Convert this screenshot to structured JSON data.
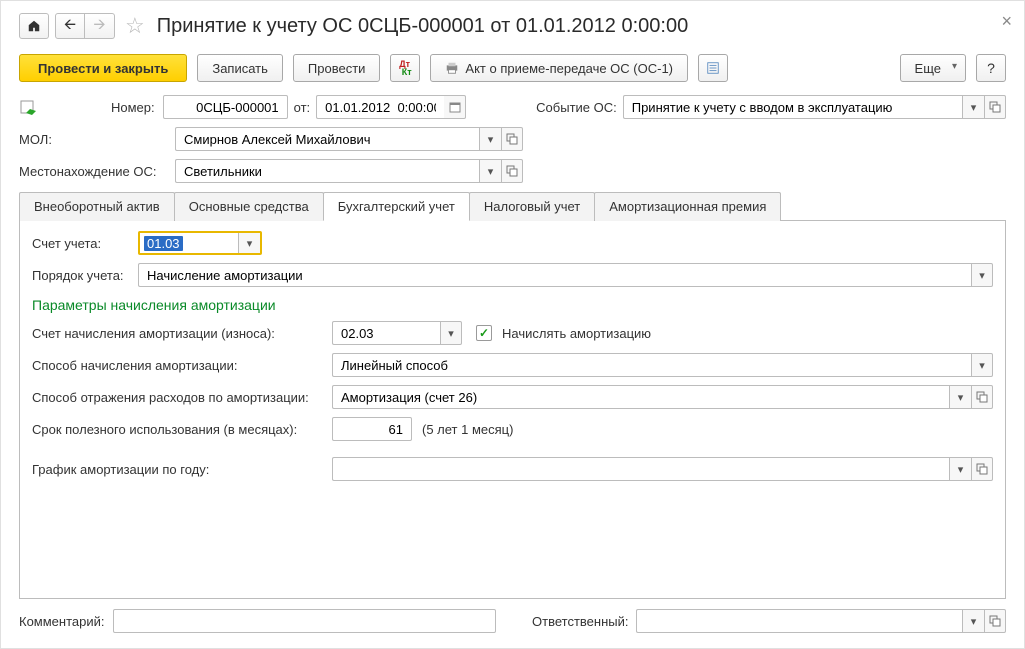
{
  "title": "Принятие к учету ОС 0СЦБ-000001 от 01.01.2012 0:00:00",
  "toolbar": {
    "post_close": "Провести и закрыть",
    "save": "Записать",
    "post": "Провести",
    "print_act": "Акт о приеме-передаче ОС (ОС-1)",
    "more": "Еще",
    "help": "?"
  },
  "fields": {
    "number_lbl": "Номер:",
    "number": "0СЦБ-000001",
    "from_lbl": "от:",
    "date": "01.01.2012  0:00:00",
    "event_lbl": "Событие ОС:",
    "event": "Принятие к учету с вводом в эксплуатацию",
    "mol_lbl": "МОЛ:",
    "mol": "Смирнов Алексей Михайлович",
    "loc_lbl": "Местонахождение ОС:",
    "loc": "Светильники"
  },
  "tabs": [
    "Внеоборотный актив",
    "Основные средства",
    "Бухгалтерский учет",
    "Налоговый учет",
    "Амортизационная премия"
  ],
  "active_tab": 2,
  "bu": {
    "account_lbl": "Счет учета:",
    "account": "01.03",
    "order_lbl": "Порядок учета:",
    "order": "Начисление амортизации",
    "section": "Параметры начисления амортизации",
    "amort_acc_lbl": "Счет начисления амортизации (износа):",
    "amort_acc": "02.03",
    "charge_chk_lbl": "Начислять амортизацию",
    "method_lbl": "Способ начисления амортизации:",
    "method": "Линейный способ",
    "expense_lbl": "Способ отражения расходов по амортизации:",
    "expense": "Амортизация (счет 26)",
    "life_lbl": "Срок полезного использования (в месяцах):",
    "life": "61",
    "life_hint": "(5 лет 1 месяц)",
    "graph_lbl": "График амортизации по году:",
    "graph": ""
  },
  "footer": {
    "comment_lbl": "Комментарий:",
    "comment": "",
    "resp_lbl": "Ответственный:",
    "resp": ""
  }
}
